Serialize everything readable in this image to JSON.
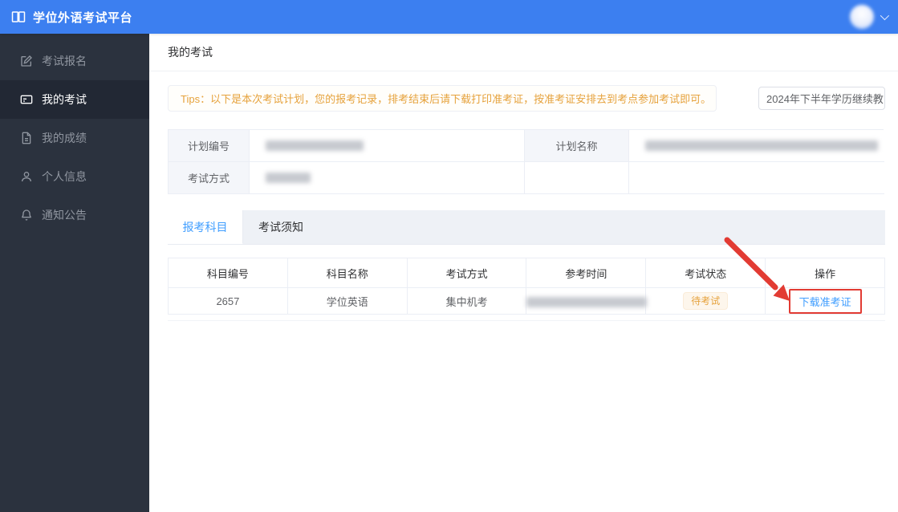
{
  "topbar": {
    "title": "学位外语考试平台",
    "brand_icon": "book-icon",
    "avatar": "blurred-user-photo",
    "dropdown_icon": "chevron-down-icon"
  },
  "sidebar": {
    "items": [
      {
        "label": "考试报名",
        "icon": "edit-square-icon",
        "active": false
      },
      {
        "label": "我的考试",
        "icon": "exam-card-icon",
        "active": true
      },
      {
        "label": "我的成绩",
        "icon": "document-icon",
        "active": false
      },
      {
        "label": "个人信息",
        "icon": "user-icon",
        "active": false
      },
      {
        "label": "通知公告",
        "icon": "bell-icon",
        "active": false
      }
    ]
  },
  "page": {
    "title": "我的考试"
  },
  "tips": {
    "text": "Tips：以下是本次考试计划，您的报考记录，排考结束后请下载打印准考证，按准考证安排去到考点参加考试即可。"
  },
  "plan_select": {
    "value": "2024年下半年学历继续教",
    "icon": "chevron-down-icon"
  },
  "plan_info": {
    "plan_no_label": "计划编号",
    "plan_name_label": "计划名称",
    "exam_mode_label": "考试方式",
    "plan_no_value": "(blurred)",
    "plan_name_value": "(blurred)",
    "exam_mode_value": "(blurred)"
  },
  "tabs": [
    {
      "label": "报考科目",
      "active": true
    },
    {
      "label": "考试须知",
      "active": false
    }
  ],
  "subjects": {
    "columns": [
      "科目编号",
      "科目名称",
      "考试方式",
      "参考时间",
      "考试状态",
      "操作"
    ],
    "rows": [
      {
        "code": "2657",
        "name": "学位英语",
        "mode": "集中机考",
        "time": "(blurred)",
        "status": "待考试",
        "action": "下载准考证"
      }
    ]
  },
  "annotation": {
    "type": "red-arrow-and-box",
    "target": "下载准考证"
  },
  "colors": {
    "header_blue": "#3c7ff0",
    "sidebar_dark": "#2b323e",
    "sidebar_active_bg": "#222834",
    "warning_orange": "#e6a23c",
    "warning_badge_bg": "#fdf6ec",
    "link_blue": "#409eff",
    "annotation_red": "#e23b33",
    "table_border": "#ebeef5",
    "label_cell_bg": "#f4f6fa",
    "tabbar_bg": "#eef1f6"
  }
}
